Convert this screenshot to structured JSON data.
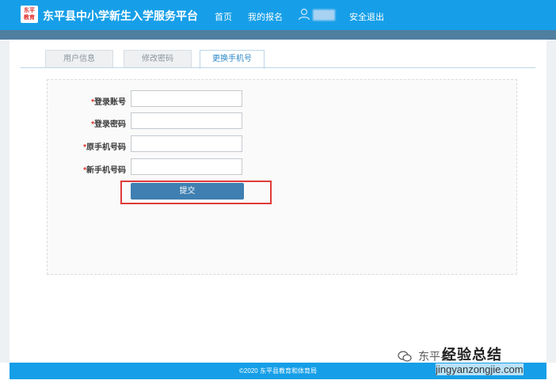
{
  "header": {
    "logo_text": "东平\n教育",
    "title": "东平县中小学新生入学服务平台",
    "nav": {
      "home": "首页",
      "my_registration": "我的报名",
      "logout": "安全退出"
    },
    "user_icon": "user-icon"
  },
  "tabs": [
    {
      "label": "用户信息",
      "active": false
    },
    {
      "label": "修改密码",
      "active": false
    },
    {
      "label": "更换手机号",
      "active": true
    }
  ],
  "form": {
    "required_mark": "*",
    "fields": [
      {
        "label": "登录账号",
        "value": ""
      },
      {
        "label": "登录密码",
        "value": ""
      },
      {
        "label": "原手机号码",
        "value": ""
      },
      {
        "label": "新手机号码",
        "value": ""
      }
    ],
    "submit_label": "提交"
  },
  "footer": {
    "text": "©2020  东平县教育和体育局"
  },
  "watermark": {
    "source": "东平县",
    "brand": "经验总结",
    "url": "jingyanzongjie.com"
  },
  "colors": {
    "header_blue": "#169fe8",
    "button_blue": "#3f7fb1",
    "highlight_red": "#e03a3a",
    "required_red": "#e0302b"
  }
}
